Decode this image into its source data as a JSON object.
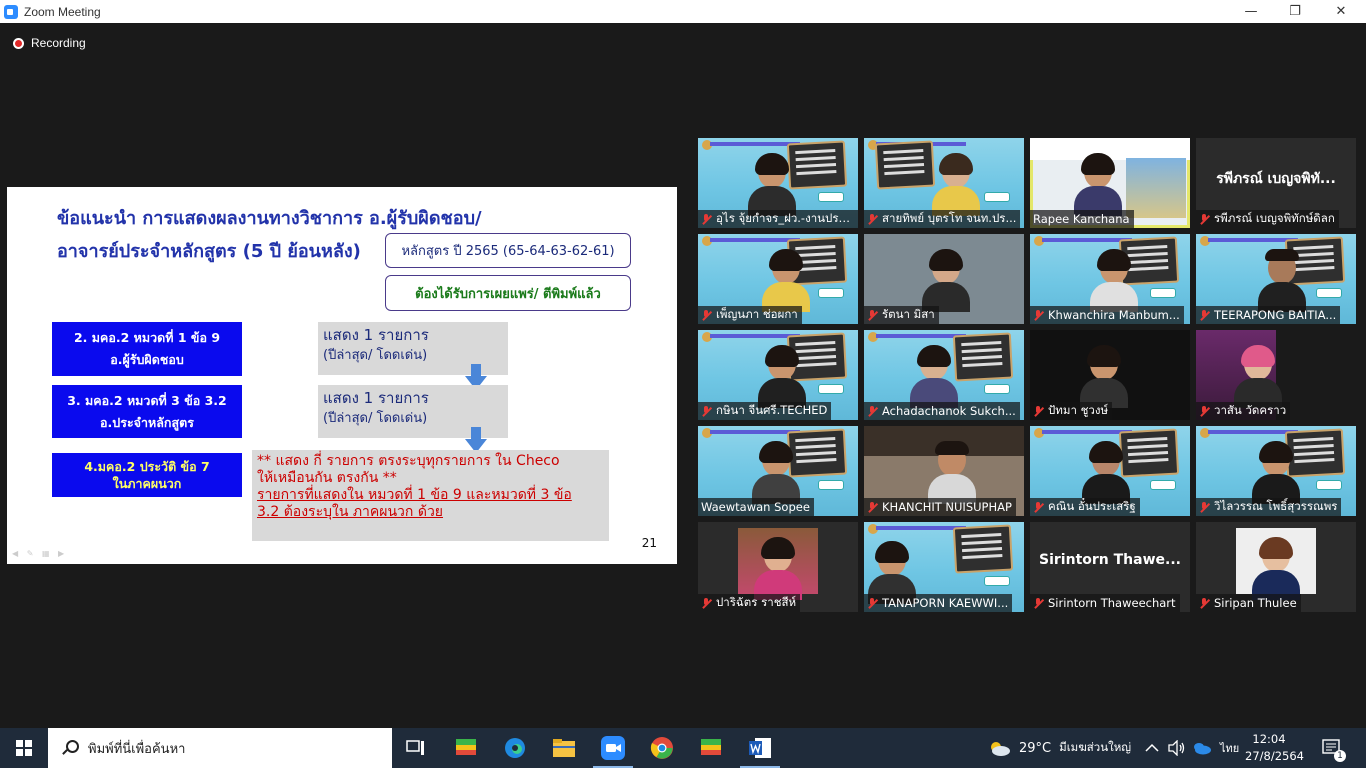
{
  "window": {
    "title": "Zoom Meeting",
    "minimize_glyph": "—",
    "restore_glyph": "❐",
    "close_glyph": "✕"
  },
  "recording": {
    "label": "Recording"
  },
  "slide": {
    "heading_line1": "ข้อแนะนำ การแสดงผลงานทางวิชาการ อ.ผู้รับผิดชอบ/",
    "heading_line2": "อาจารย์ประจำหลักสูตร (5 ปี ย้อนหลัง)",
    "curriculum_box": "หลักสูตร ปี 2565 (65-64-63-62-61)",
    "published_box": "ต้องได้รับการเผยแพร่/ ตีพิมพ์แล้ว",
    "item1_line1": "2. มคอ.2 หมวดที่  1 ข้อ 9",
    "item1_line2": "อ.ผู้รับผิดชอบ",
    "item2_line1": "3. มคอ.2 หมวดที่ 3 ข้อ 3.2",
    "item2_line2": "อ.ประจำหลักสูตร",
    "item3_line1": "4.มคอ.2 ประวัติ ข้อ 7",
    "item3_line2": "ในภาคผนวก",
    "show1_line1": "แสดง  1  รายการ",
    "show1_line2": "(ปีล่าสุด/ โดดเด่น)",
    "show2_line1": "แสดง  1  รายการ",
    "show2_line2": "(ปีล่าสุด/ โดดเด่น)",
    "note_line1": "** แสดง กี่ รายการ ตรงระบุทุกรายการ ใน Checo",
    "note_line2": "ให้เหมือนกัน ตรงกัน **",
    "note_line3": "รายการที่แสดงใน หมวดที่ 1 ข้อ 9 และหมวดที่ 3 ข้อ",
    "note_line4": "3.2 ต้องระบุใน ภาคผนวก ด้วย",
    "page_number": "21",
    "colors": {
      "heading": "#2233aa",
      "blue_box": "#0a0aee",
      "note_red": "#cc0000"
    }
  },
  "participants": [
    {
      "name": "อุไร จุ้ยกำจร_ฝว.-งานประ..."
    },
    {
      "name": "สายทิพย์ บุตรโท จนท.ปร..."
    },
    {
      "name": "Rapee Kanchana"
    },
    {
      "name": "รพีภรณ์ เบญจพิทักษ์ดิลก",
      "video_off_name": "รพีภรณ์ เบญจพิทั..."
    },
    {
      "name": "เพ็ญนภา ช่อผกา"
    },
    {
      "name": "รัตนา มิสา"
    },
    {
      "name": "Khwanchira Manbum..."
    },
    {
      "name": "TEERAPONG  BAITIA..."
    },
    {
      "name": "กษินา  จีนศรี.TECHED"
    },
    {
      "name": "Achadachanok  Sukch..."
    },
    {
      "name": "ปัทมา ชูวงษ์"
    },
    {
      "name": "วาสัน วัดคราว"
    },
    {
      "name": "Waewtawan Sopee"
    },
    {
      "name": "KHANCHIT NUISUPHAP"
    },
    {
      "name": "คณิน อั๋นประเสริฐ"
    },
    {
      "name": "วิไลวรรณ โพธิ์สุวรรณพร"
    },
    {
      "name": "ปาริฉัตร  ราชสีห์"
    },
    {
      "name": "TANAPORN KAEWWI..."
    },
    {
      "name": "Sirintorn Thaweechart",
      "video_off_name": "Sirintorn  Thawe..."
    },
    {
      "name": "Siripan Thulee"
    }
  ],
  "taskbar": {
    "search_placeholder": "พิมพ์ที่นี่เพื่อค้นหา",
    "weather_temp": "29°C",
    "weather_text": "มีเมฆส่วนใหญ่",
    "language": "ไทย",
    "time": "12:04",
    "date": "27/8/2564",
    "notification_count": "1",
    "icons": [
      "windows-icon",
      "search-icon",
      "task-view-icon",
      "bluestacks-icon",
      "edge-icon",
      "file-explorer-icon",
      "zoom-icon",
      "chrome-icon",
      "bluestacks-icon",
      "word-icon"
    ]
  }
}
